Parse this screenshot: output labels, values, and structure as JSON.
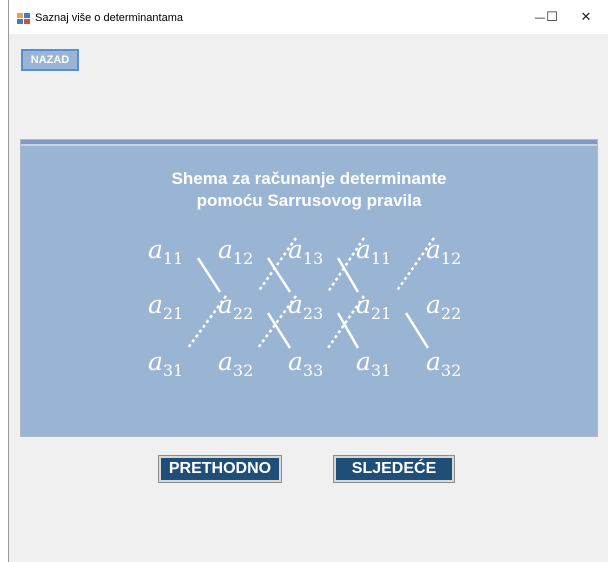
{
  "window": {
    "title": "Saznaj više o determinantama",
    "minimize_glyph": "—",
    "maximize_glyph": "☐",
    "close_glyph": "✕",
    "icon": "winforms-app-icon"
  },
  "toolbar": {
    "back_label": "NAZAD"
  },
  "panel": {
    "title_line1": "Shema za računanje determinante",
    "title_line2": "pomoću Sarrusovog pravila",
    "base_letter": "a",
    "matrix": [
      [
        "11",
        "12",
        "13",
        "11",
        "12"
      ],
      [
        "21",
        "22",
        "23",
        "21",
        "22"
      ],
      [
        "31",
        "32",
        "33",
        "31",
        "32"
      ]
    ],
    "colors": {
      "background": "#9ab4d4",
      "text": "#ffffff"
    }
  },
  "navigation": {
    "prev_label": "PRETHODNO",
    "next_label": "SLJEDEĆE"
  },
  "colors": {
    "nav_button": "#1f4e79",
    "back_button": "#9ab4d5",
    "back_border": "#5b8ed1"
  }
}
